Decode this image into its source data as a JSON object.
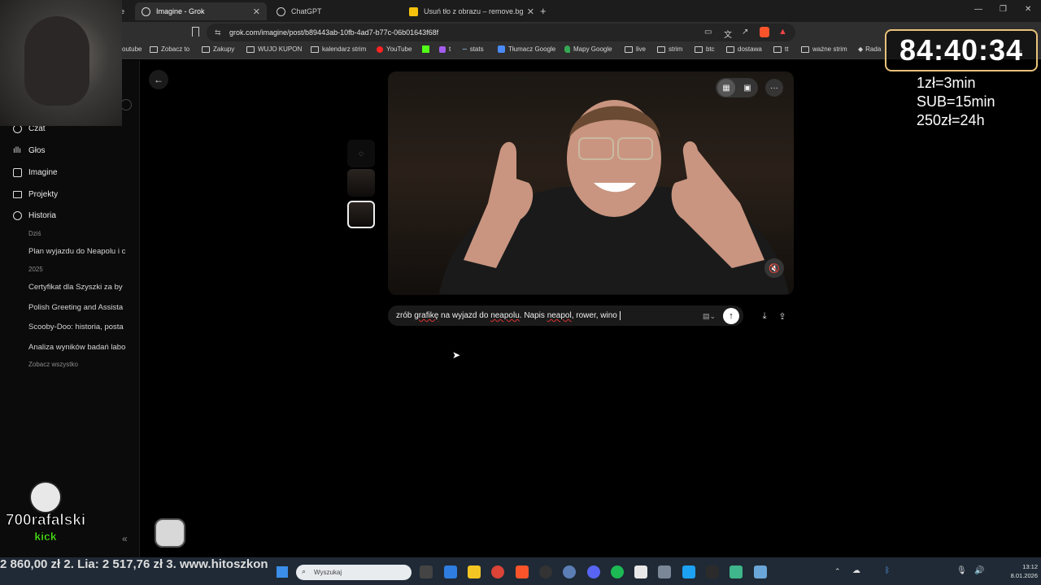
{
  "browser": {
    "tabs": [
      {
        "label": "e"
      },
      {
        "label": "Imagine - Grok",
        "active": true
      },
      {
        "label": "ChatGPT"
      },
      {
        "label": "Usuń tło z obrazu – remove.bg"
      }
    ],
    "url": "grok.com/imagine/post/b89443ab-10fb-4ad7-b77c-06b01643f68f",
    "bookmarks": [
      "outube",
      "Zobacz to",
      "Zakupy",
      "WUJO KUPON",
      "kalendarz strim",
      "YouTube",
      "t",
      "stats",
      "Tłumacz Google",
      "Mapy Google",
      "live",
      "strim",
      "btc",
      "dostawa",
      "tt",
      "ważne strim",
      "Rada"
    ]
  },
  "sidebar": {
    "nav": [
      {
        "label": "Czat",
        "icon": "chat-icon"
      },
      {
        "label": "Głos",
        "icon": "voice-icon"
      },
      {
        "label": "Imagine",
        "icon": "imagine-icon"
      },
      {
        "label": "Projekty",
        "icon": "folder-icon"
      },
      {
        "label": "Historia",
        "icon": "history-icon"
      }
    ],
    "today_label": "Dziś",
    "year_label": "2025",
    "history": [
      "Plan wyjazdu do Neapolu i c",
      "Certyfikat dla Szyszki za by",
      "Polish Greeting and Assista",
      "Scooby-Doo: historia, posta",
      "Analiza wyników badań labo"
    ],
    "see_all": "Zobacz wszystko"
  },
  "prompt": {
    "text_start": "zrób ",
    "text_sq1": "grafikę",
    "text_mid": " na wyjazd do ",
    "text_sq2": "neapolu",
    "text_mid2": ". Napis ",
    "text_sq3": "neapol",
    "text_end": ", rower, wino "
  },
  "overlay": {
    "timer": "84:40:34",
    "rates": [
      "1zł=3min",
      "SUB=15min",
      "250zł=24h"
    ],
    "ticker": "2 860,00 zł    2. Lia: 2 517,76 zł    3. www.hitoszkon",
    "streamer_name": "700rafalski",
    "kick": "kick"
  },
  "taskbar": {
    "search_placeholder": "Wyszukaj",
    "time": "13:12",
    "date": "8.01.2026"
  },
  "colors": {
    "accent": "#e9c27a",
    "kick_green": "#53fc18",
    "brave": "#fb542b"
  }
}
